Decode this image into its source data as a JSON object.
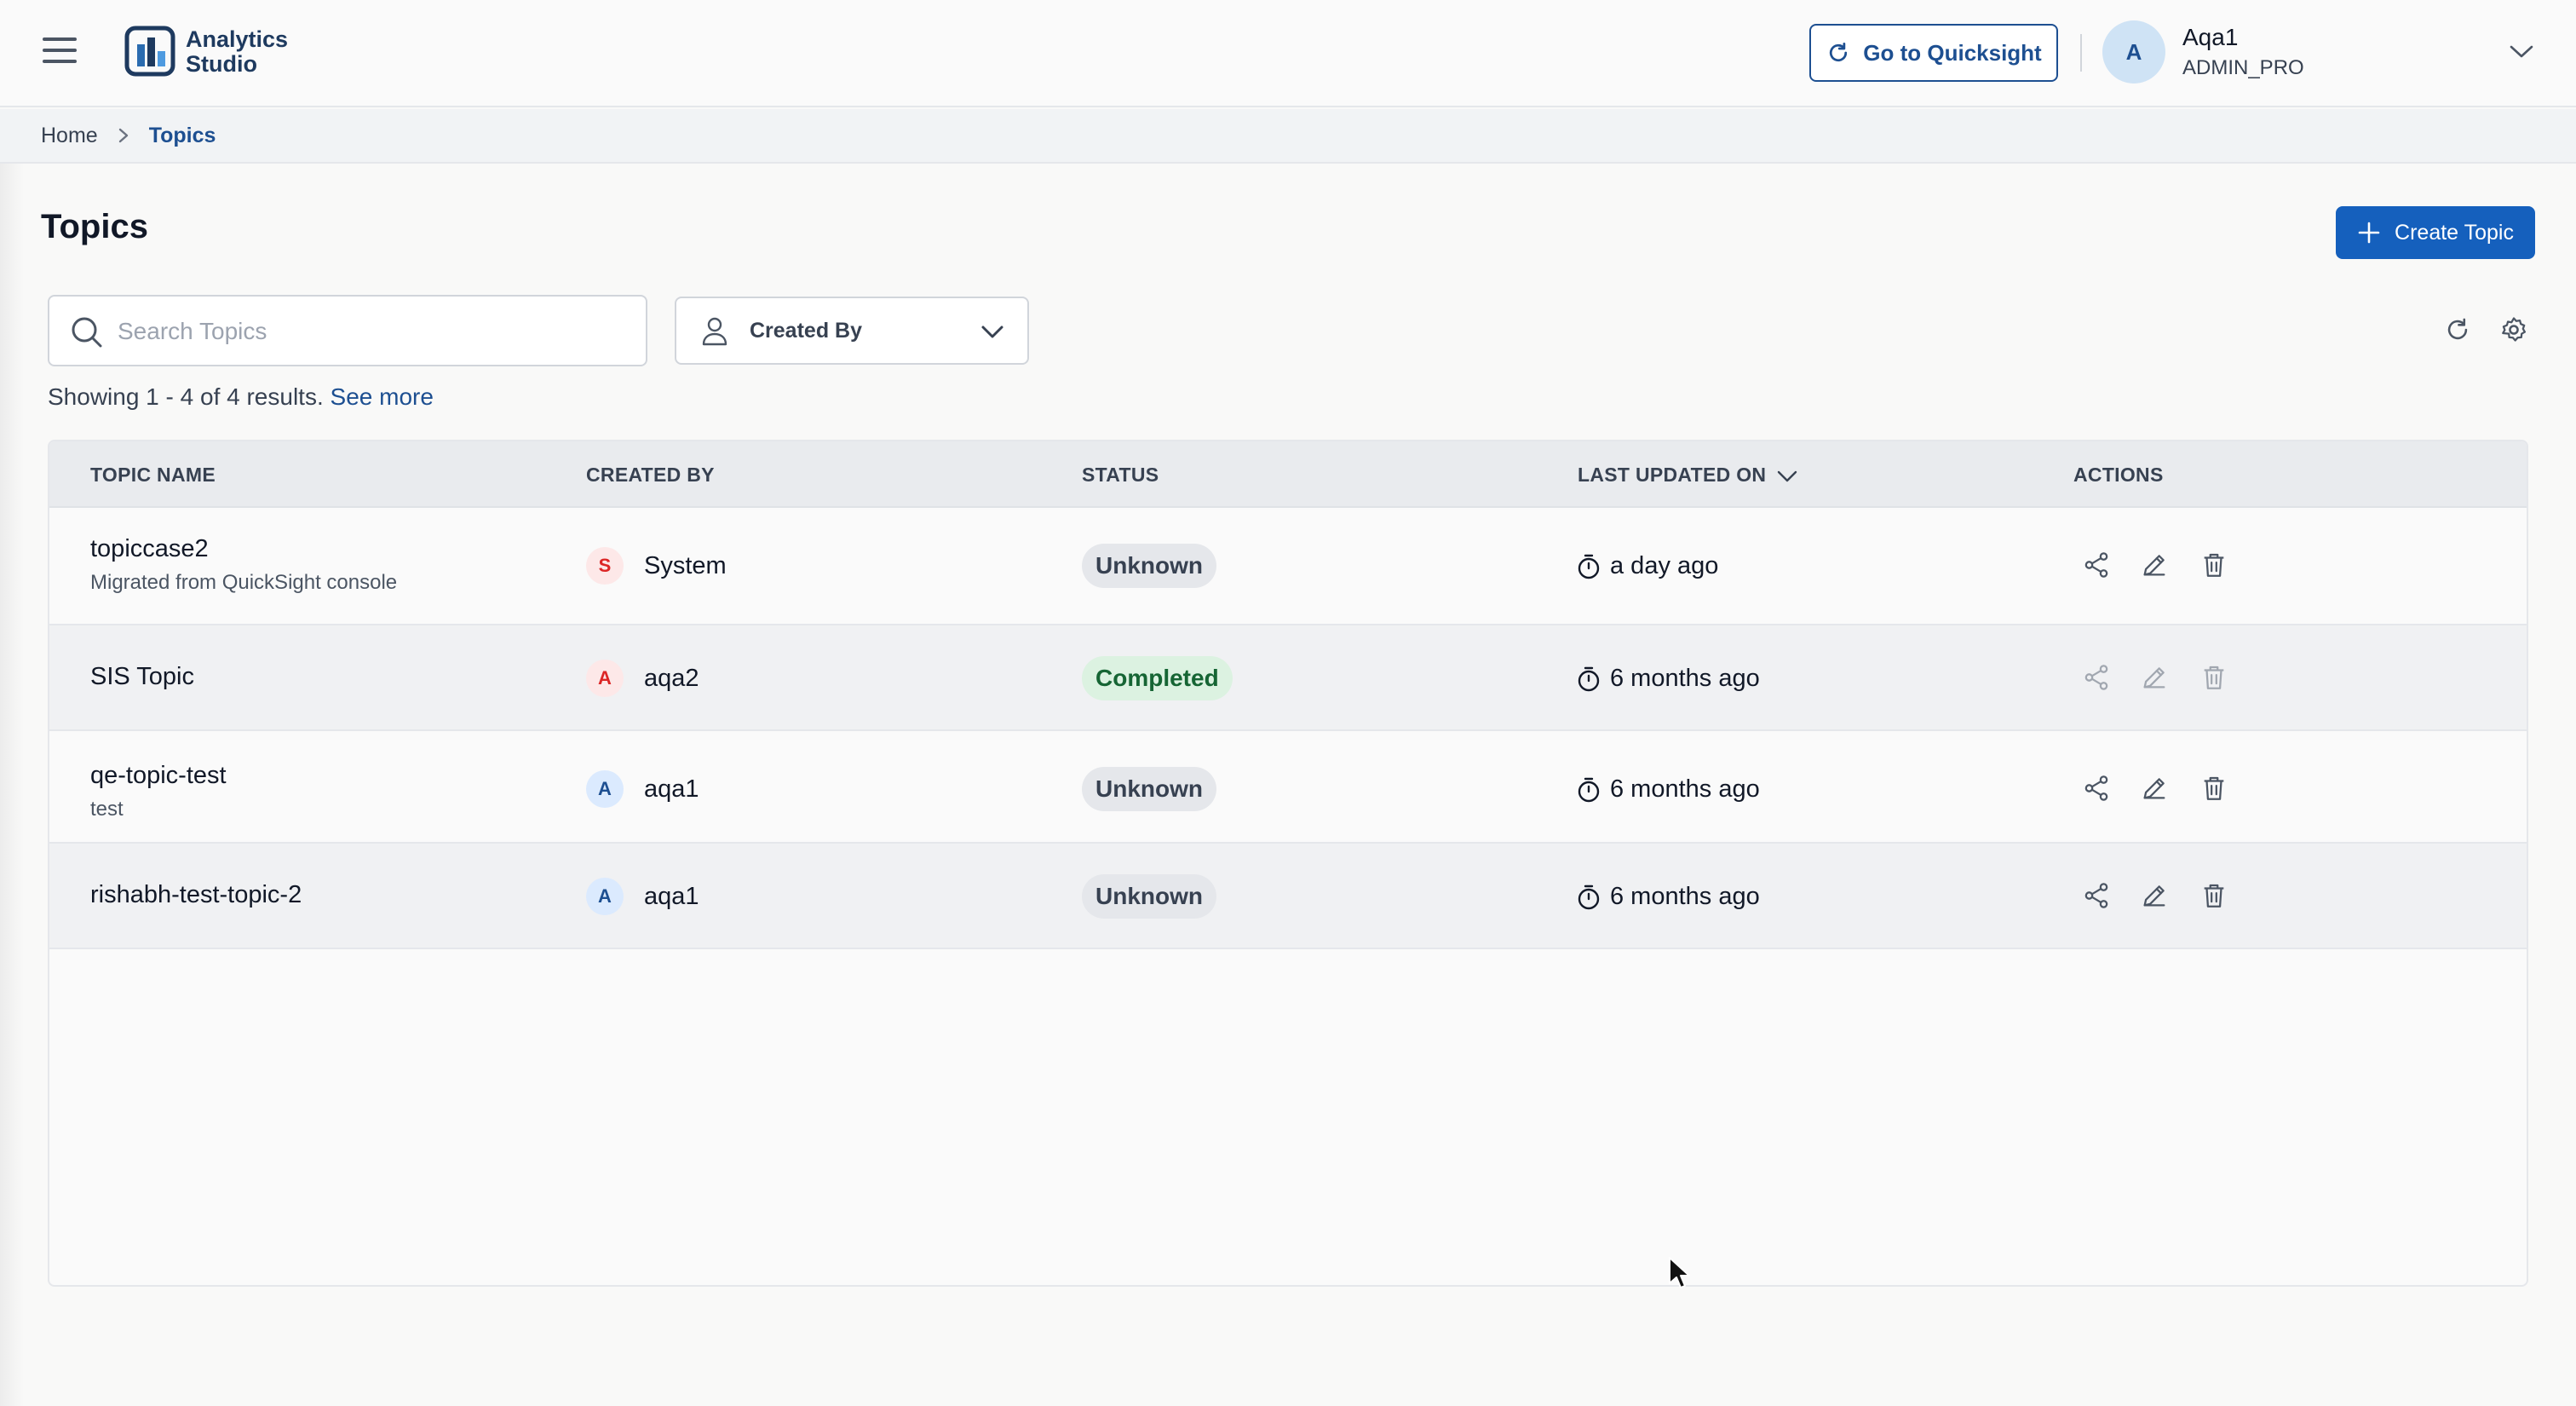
{
  "header": {
    "app_name_line1": "Analytics",
    "app_name_line2": "Studio",
    "quicksight_label": "Go to Quicksight",
    "user": {
      "avatar_letter": "A",
      "name": "Aqa1",
      "role": "ADMIN_PRO"
    }
  },
  "breadcrumb": {
    "home": "Home",
    "current": "Topics"
  },
  "page": {
    "title": "Topics",
    "create_label": "Create Topic"
  },
  "filters": {
    "search_placeholder": "Search Topics",
    "created_by_label": "Created By"
  },
  "results": {
    "text": "Showing 1 - 4 of 4 results.",
    "see_more": "See more"
  },
  "table": {
    "columns": [
      "TOPIC NAME",
      "CREATED BY",
      "STATUS",
      "LAST UPDATED ON",
      "ACTIONS"
    ],
    "rows": [
      {
        "name": "topiccase2",
        "description": "Migrated from QuickSight console",
        "creator_letter": "S",
        "creator": "System",
        "status": "Unknown",
        "updated": "a day ago"
      },
      {
        "name": "SIS Topic",
        "description": "",
        "creator_letter": "A",
        "creator": "aqa2",
        "status": "Completed",
        "updated": "6 months ago"
      },
      {
        "name": "qe-topic-test",
        "description": "test",
        "creator_letter": "A",
        "creator": "aqa1",
        "status": "Unknown",
        "updated": "6 months ago"
      },
      {
        "name": "rishabh-test-topic-2",
        "description": "",
        "creator_letter": "A",
        "creator": "aqa1",
        "status": "Unknown",
        "updated": "6 months ago"
      }
    ]
  },
  "colors": {
    "brand": "#1d4f91",
    "primary_button": "#1560bd",
    "status_completed_bg": "#dcf2e1",
    "status_unknown_bg": "#e5e7eb"
  },
  "icons": [
    "menu-icon",
    "app-logo-icon",
    "refresh-link-icon",
    "chevron-down-icon",
    "chevron-right-icon",
    "plus-icon",
    "search-icon",
    "user-icon",
    "refresh-icon",
    "settings-icon",
    "timer-icon",
    "share-icon",
    "edit-icon",
    "delete-icon"
  ]
}
